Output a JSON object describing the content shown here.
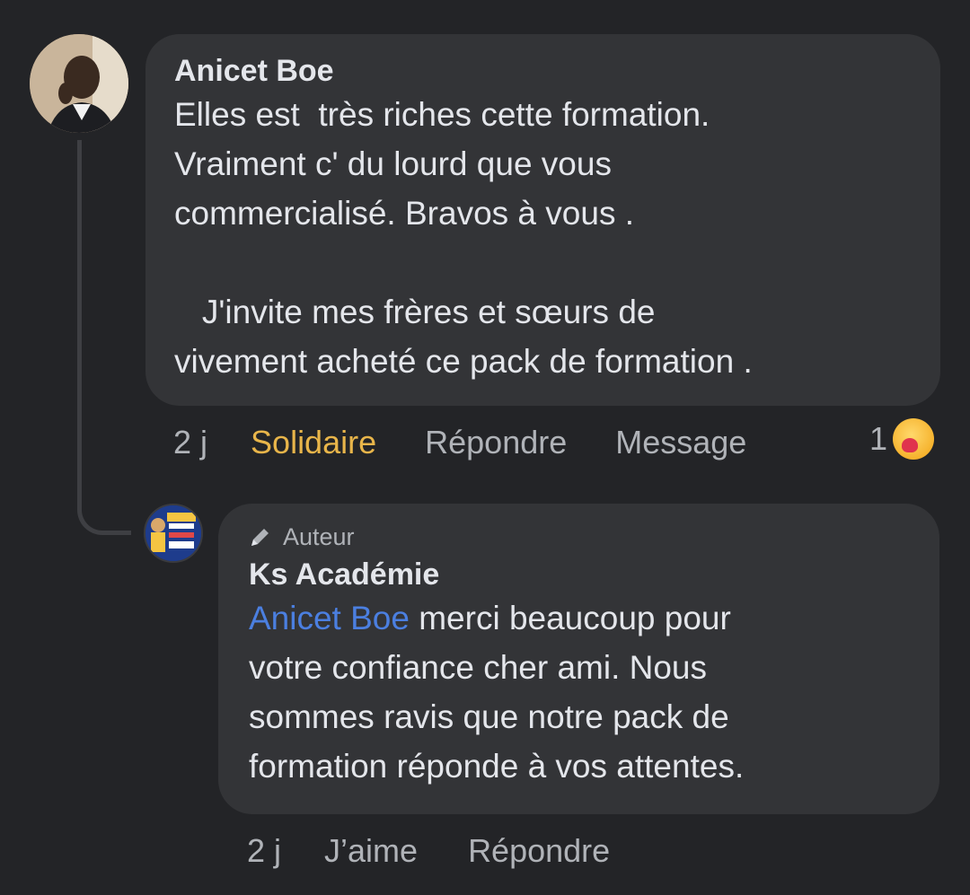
{
  "comment": {
    "author": "Anicet Boe",
    "text": "Elles est  très riches cette formation.\nVraiment c' du lourd que vous\ncommercialisé. Bravos à vous .\n\n   J'invite mes frères et sœurs de\nvivement acheté ce pack de formation .",
    "actions": {
      "time": "2 j",
      "like": "Solidaire",
      "reply": "Répondre",
      "message": "Message"
    },
    "reaction": {
      "count": "1",
      "icon": "care-emoji-icon"
    },
    "like_active_color": "#e8b54a"
  },
  "reply": {
    "author_badge": "Auteur",
    "author": "Ks Académie",
    "mention": "Anicet Boe",
    "text": " merci beaucoup pour\nvotre confiance cher ami. Nous\nsommes ravis que notre pack de\nformation réponde à vos attentes.",
    "actions": {
      "time": "2 j",
      "like": "J’aime",
      "reply": "Répondre"
    },
    "mention_color": "#4b7fe0"
  }
}
